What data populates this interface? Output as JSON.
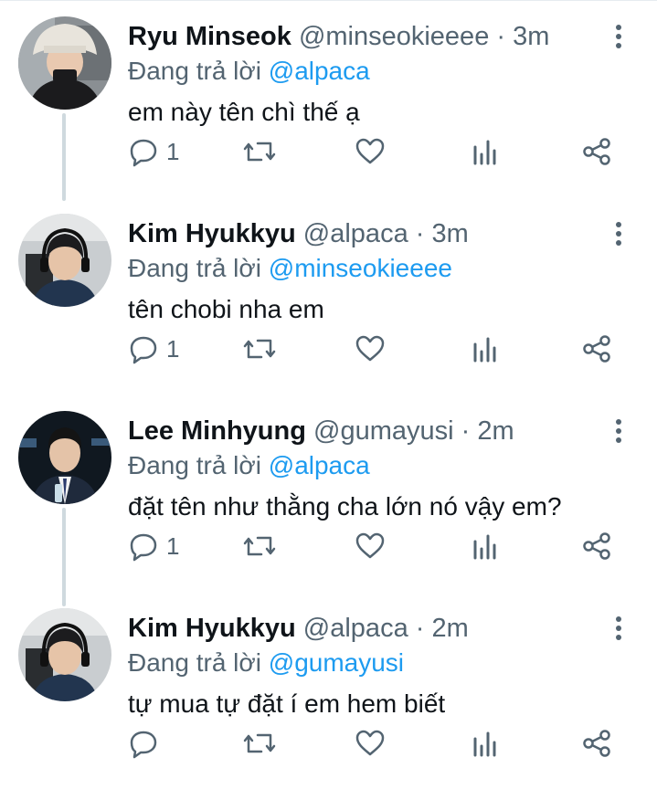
{
  "reply_prefix": "Đang trả lời",
  "colors": {
    "mention": "#1d9bf0",
    "secondary": "#536471",
    "text": "#0f1419",
    "thread_line": "#cfd9de"
  },
  "tweets": [
    {
      "name": "Ryu Minseok",
      "handle": "@minseokieeee",
      "separator": "·",
      "time": "3m",
      "reply_to": "@alpaca",
      "text": "em này tên chì thế ạ",
      "reply_count": "1",
      "avatar": "person-bucket-hat-photo"
    },
    {
      "name": "Kim Hyukkyu",
      "handle": "@alpaca",
      "separator": "·",
      "time": "3m",
      "reply_to": "@minseokieeee",
      "text": "tên chobi nha em",
      "reply_count": "1",
      "avatar": "person-headset-photo"
    },
    {
      "name": "Lee Minhyung",
      "handle": "@gumayusi",
      "separator": "·",
      "time": "2m",
      "reply_to": "@alpaca",
      "text": "đặt tên như thằng cha lớn nó vậy em?",
      "reply_count": "1",
      "avatar": "person-suit-photo"
    },
    {
      "name": "Kim Hyukkyu",
      "handle": "@alpaca",
      "separator": "·",
      "time": "2m",
      "reply_to": "@gumayusi",
      "text": "tự mua tự đặt í em hem biết",
      "reply_count": "",
      "avatar": "person-headset-photo"
    }
  ]
}
